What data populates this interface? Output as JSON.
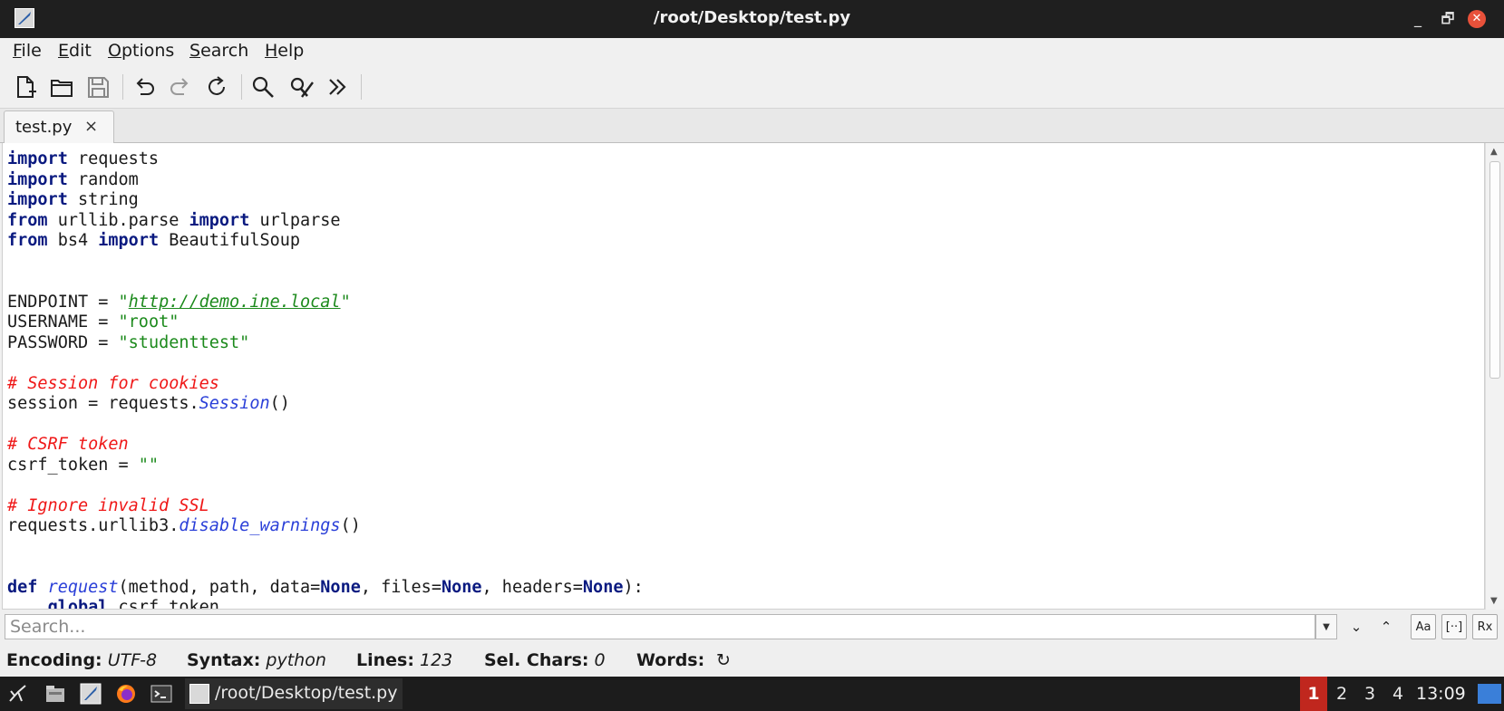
{
  "window": {
    "title": "/root/Desktop/test.py",
    "minimize_glyph": "_",
    "maximize_glyph": "🗗",
    "close_glyph": "✕"
  },
  "menu": [
    {
      "label": "File",
      "accel": "F",
      "rest": "ile"
    },
    {
      "label": "Edit",
      "accel": "E",
      "rest": "dit"
    },
    {
      "label": "Options",
      "accel": "O",
      "rest": "ptions"
    },
    {
      "label": "Search",
      "accel": "S",
      "rest": "earch"
    },
    {
      "label": "Help",
      "accel": "H",
      "rest": "elp"
    }
  ],
  "toolbar": {
    "icons": [
      "new-file-icon",
      "open-folder-icon",
      "save-icon",
      "undo-icon",
      "redo-icon",
      "reload-icon",
      "find-icon",
      "replace-icon",
      "more-icon"
    ]
  },
  "tab": {
    "label": "test.py",
    "close": "×"
  },
  "code_lines": [
    [
      {
        "t": "import",
        "c": "kw"
      },
      {
        "t": " requests",
        "c": ""
      }
    ],
    [
      {
        "t": "import",
        "c": "kw"
      },
      {
        "t": " random",
        "c": ""
      }
    ],
    [
      {
        "t": "import",
        "c": "kw"
      },
      {
        "t": " string",
        "c": ""
      }
    ],
    [
      {
        "t": "from",
        "c": "kw"
      },
      {
        "t": " urllib.parse ",
        "c": ""
      },
      {
        "t": "import",
        "c": "kw"
      },
      {
        "t": " urlparse",
        "c": ""
      }
    ],
    [
      {
        "t": "from",
        "c": "kw"
      },
      {
        "t": " bs4 ",
        "c": ""
      },
      {
        "t": "import",
        "c": "kw"
      },
      {
        "t": " BeautifulSoup",
        "c": ""
      }
    ],
    [],
    [],
    [
      {
        "t": "ENDPOINT = ",
        "c": ""
      },
      {
        "t": "\"",
        "c": "str"
      },
      {
        "t": "http://demo.ine.local",
        "c": "url"
      },
      {
        "t": "\"",
        "c": "str"
      }
    ],
    [
      {
        "t": "USERNAME = ",
        "c": ""
      },
      {
        "t": "\"root\"",
        "c": "str"
      }
    ],
    [
      {
        "t": "PASSWORD = ",
        "c": ""
      },
      {
        "t": "\"studenttest\"",
        "c": "str"
      }
    ],
    [],
    [
      {
        "t": "# Session for cookies",
        "c": "cmt"
      }
    ],
    [
      {
        "t": "session = requests.",
        "c": ""
      },
      {
        "t": "Session",
        "c": "fn"
      },
      {
        "t": "()",
        "c": ""
      }
    ],
    [],
    [
      {
        "t": "# CSRF token",
        "c": "cmt"
      }
    ],
    [
      {
        "t": "csrf_token = ",
        "c": ""
      },
      {
        "t": "\"\"",
        "c": "str"
      }
    ],
    [],
    [
      {
        "t": "# Ignore invalid SSL",
        "c": "cmt"
      }
    ],
    [
      {
        "t": "requests.urllib3.",
        "c": ""
      },
      {
        "t": "disable_warnings",
        "c": "fn"
      },
      {
        "t": "()",
        "c": ""
      }
    ],
    [],
    [],
    [
      {
        "t": "def",
        "c": "kw"
      },
      {
        "t": " ",
        "c": ""
      },
      {
        "t": "request",
        "c": "fn"
      },
      {
        "t": "(method, path, data=",
        "c": ""
      },
      {
        "t": "None",
        "c": "kw"
      },
      {
        "t": ", files=",
        "c": ""
      },
      {
        "t": "None",
        "c": "kw"
      },
      {
        "t": ", headers=",
        "c": ""
      },
      {
        "t": "None",
        "c": "kw"
      },
      {
        "t": "):",
        "c": ""
      }
    ],
    [
      {
        "t": "    ",
        "c": ""
      },
      {
        "t": "global",
        "c": "kw"
      },
      {
        "t": " csrf_token",
        "c": ""
      }
    ]
  ],
  "search": {
    "placeholder": "Search...",
    "value": ""
  },
  "search_buttons": {
    "next": "⌄",
    "prev": "⌃",
    "match_case": "Aa",
    "whole_word": "[··]",
    "regex": "Rx"
  },
  "status": {
    "encoding_label": "Encoding:",
    "encoding_value": "UTF-8",
    "syntax_label": "Syntax:",
    "syntax_value": "python",
    "lines_label": "Lines:",
    "lines_value": "123",
    "sel_label": "Sel. Chars:",
    "sel_value": "0",
    "words_label": "Words:",
    "words_refresh": "↻"
  },
  "taskbar": {
    "launchers": [
      "kali-menu-icon",
      "file-manager-icon",
      "text-editor-icon",
      "firefox-icon",
      "terminal-icon"
    ],
    "task_label": "/root/Desktop/test.py",
    "workspaces": [
      "1",
      "2",
      "3",
      "4"
    ],
    "active_workspace": "1",
    "clock": "13:09"
  },
  "colors": {
    "keyword": "#0a1a80",
    "string": "#1c8a1c",
    "comment": "#ef1818",
    "function": "#2a3fd8",
    "titlebar": "#1f1f1f",
    "active_workspace": "#c0271e"
  }
}
